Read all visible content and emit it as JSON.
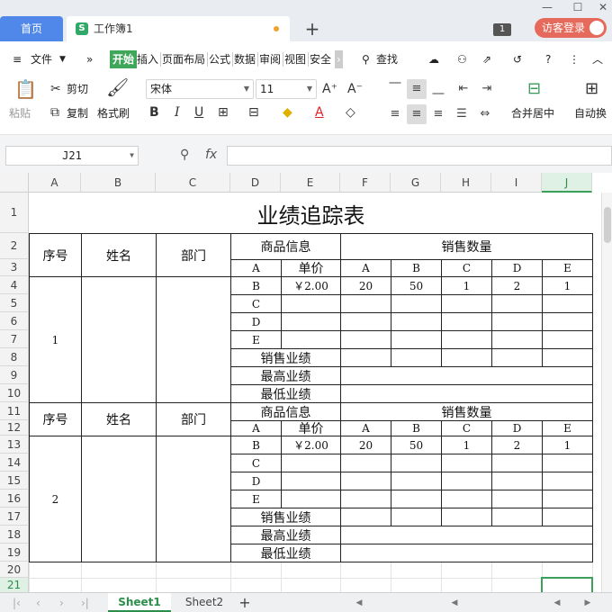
{
  "tabs": {
    "home": "首页",
    "doc": "工作簿1",
    "doc_icon": "S",
    "new_tab": "+"
  },
  "titlebar": {
    "badge": "1",
    "login": "访客登录",
    "win_min": "—",
    "win_max": "☐",
    "win_close": "✕"
  },
  "menubar": {
    "file": "文件",
    "items": [
      "开始",
      "插入",
      "页面布局",
      "公式",
      "数据",
      "审阅",
      "视图",
      "安全"
    ],
    "search": "查找"
  },
  "ribbon": {
    "paste": "粘贴",
    "cut": "剪切",
    "copy": "复制",
    "format_painter": "格式刷",
    "font_name": "宋体",
    "font_size": "11",
    "merge_center": "合并居中",
    "auto_wrap": "自动换"
  },
  "formula": {
    "cell_ref": "J21",
    "fx": "fx",
    "value": ""
  },
  "grid": {
    "columns": [
      "A",
      "B",
      "C",
      "D",
      "E",
      "F",
      "G",
      "H",
      "I",
      "J"
    ],
    "rows": [
      "1",
      "2",
      "3",
      "4",
      "5",
      "6",
      "7",
      "8",
      "9",
      "10",
      "11",
      "12",
      "13",
      "14",
      "15",
      "16",
      "17",
      "18",
      "19",
      "20",
      "21"
    ],
    "active_column": "J",
    "active_row": "21",
    "title": "业绩追踪表",
    "blocks": [
      {
        "seq_header": "序号",
        "name_header": "姓名",
        "dept_header": "部门",
        "product_info": "商品信息",
        "sales_qty": "销售数量",
        "product_col": "A",
        "price_col": "单价",
        "qty_cols": [
          "A",
          "B",
          "C",
          "D",
          "E"
        ],
        "seq_value": "1",
        "product_rows": [
          {
            "product": "B",
            "price": "￥2.00",
            "qty": [
              "20",
              "50",
              "1",
              "2",
              "1"
            ]
          },
          {
            "product": "C",
            "price": "",
            "qty": [
              "",
              "",
              "",
              "",
              ""
            ]
          },
          {
            "product": "D",
            "price": "",
            "qty": [
              "",
              "",
              "",
              "",
              ""
            ]
          },
          {
            "product": "E",
            "price": "",
            "qty": [
              "",
              "",
              "",
              "",
              ""
            ]
          }
        ],
        "sales_perf": "销售业绩",
        "max_perf": "最高业绩",
        "min_perf": "最低业绩"
      },
      {
        "seq_header": "序号",
        "name_header": "姓名",
        "dept_header": "部门",
        "product_info": "商品信息",
        "sales_qty": "销售数量",
        "product_col": "A",
        "price_col": "单价",
        "qty_cols": [
          "A",
          "B",
          "C",
          "D",
          "E"
        ],
        "seq_value": "2",
        "product_rows": [
          {
            "product": "B",
            "price": "￥2.00",
            "qty": [
              "20",
              "50",
              "1",
              "2",
              "1"
            ]
          },
          {
            "product": "C",
            "price": "",
            "qty": [
              "",
              "",
              "",
              "",
              ""
            ]
          },
          {
            "product": "D",
            "price": "",
            "qty": [
              "",
              "",
              "",
              "",
              ""
            ]
          },
          {
            "product": "E",
            "price": "",
            "qty": [
              "",
              "",
              "",
              "",
              ""
            ]
          }
        ],
        "sales_perf": "销售业绩",
        "max_perf": "最高业绩",
        "min_perf": "最低业绩"
      }
    ]
  },
  "sheets": {
    "tabs": [
      "Sheet1",
      "Sheet2"
    ],
    "active": "Sheet1",
    "add": "+"
  },
  "colors": {
    "accent": "#3ea75a",
    "home_tab": "#4f88e8",
    "login": "#e56a5b"
  }
}
